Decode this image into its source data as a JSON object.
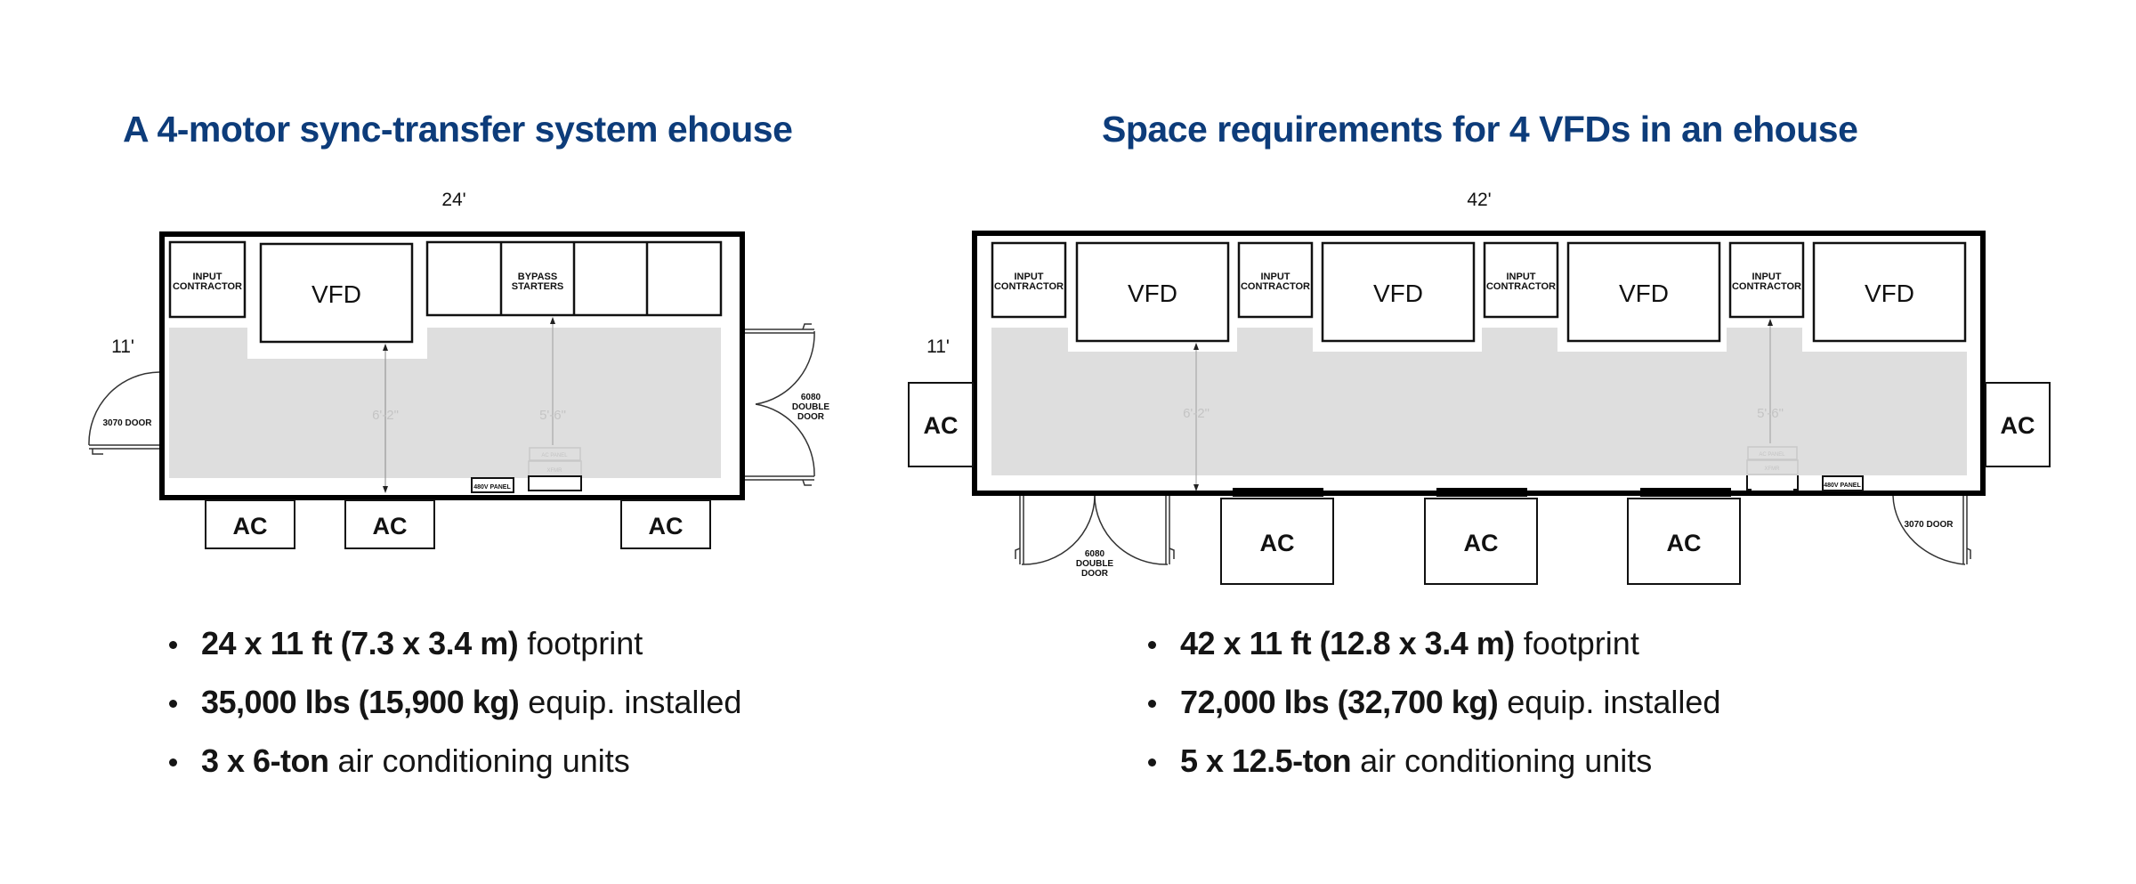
{
  "left": {
    "title": "A 4-motor sync-transfer system ehouse",
    "diagram": {
      "width_label": "24'",
      "height_label": "11'",
      "input_contractor": "INPUT\nCONTRACTOR",
      "input_line1": "INPUT",
      "input_line2": "CONTRACTOR",
      "vfd": "VFD",
      "bypass_line1": "BYPASS",
      "bypass_line2": "STARTERS",
      "clearance_1": "6'-2\"",
      "clearance_2": "5'-6\"",
      "ac_panel": "AC PANEL",
      "xfmr": "XFMR",
      "panel_480v": "480V PANEL",
      "door_single": "3070 DOOR",
      "door_double_line1": "6080",
      "door_double_line2": "DOUBLE",
      "door_double_line3": "DOOR",
      "ac_units": [
        "AC",
        "AC",
        "AC"
      ]
    },
    "bullets": [
      {
        "bold": "24 x 11 ft (7.3 x 3.4 m)",
        "rest": " footprint"
      },
      {
        "bold": "35,000 lbs (15,900 kg)",
        "rest": " equip. installed"
      },
      {
        "bold": "3 x 6-ton",
        "rest": " air conditioning units"
      }
    ]
  },
  "right": {
    "title": "Space requirements for 4 VFDs in an ehouse",
    "diagram": {
      "width_label": "42'",
      "height_label": "11'",
      "input_line1": "INPUT",
      "input_line2": "CONTRACTOR",
      "vfd": "VFD",
      "clearance_1": "6'-2\"",
      "clearance_2": "5'-6\"",
      "ac_panel": "AC PANEL",
      "xfmr": "XFMR",
      "panel_480v": "480V PANEL",
      "door_single": "3070 DOOR",
      "door_double_line1": "6080",
      "door_double_line2": "DOUBLE",
      "door_double_line3": "DOOR",
      "ac_units": [
        "AC",
        "AC",
        "AC",
        "AC",
        "AC"
      ]
    },
    "bullets": [
      {
        "bold": "42 x 11 ft (12.8 x 3.4 m)",
        "rest": " footprint"
      },
      {
        "bold": "72,000 lbs (32,700 kg)",
        "rest": " equip. installed"
      },
      {
        "bold": "5 x 12.5-ton",
        "rest": " air conditioning units"
      }
    ]
  }
}
